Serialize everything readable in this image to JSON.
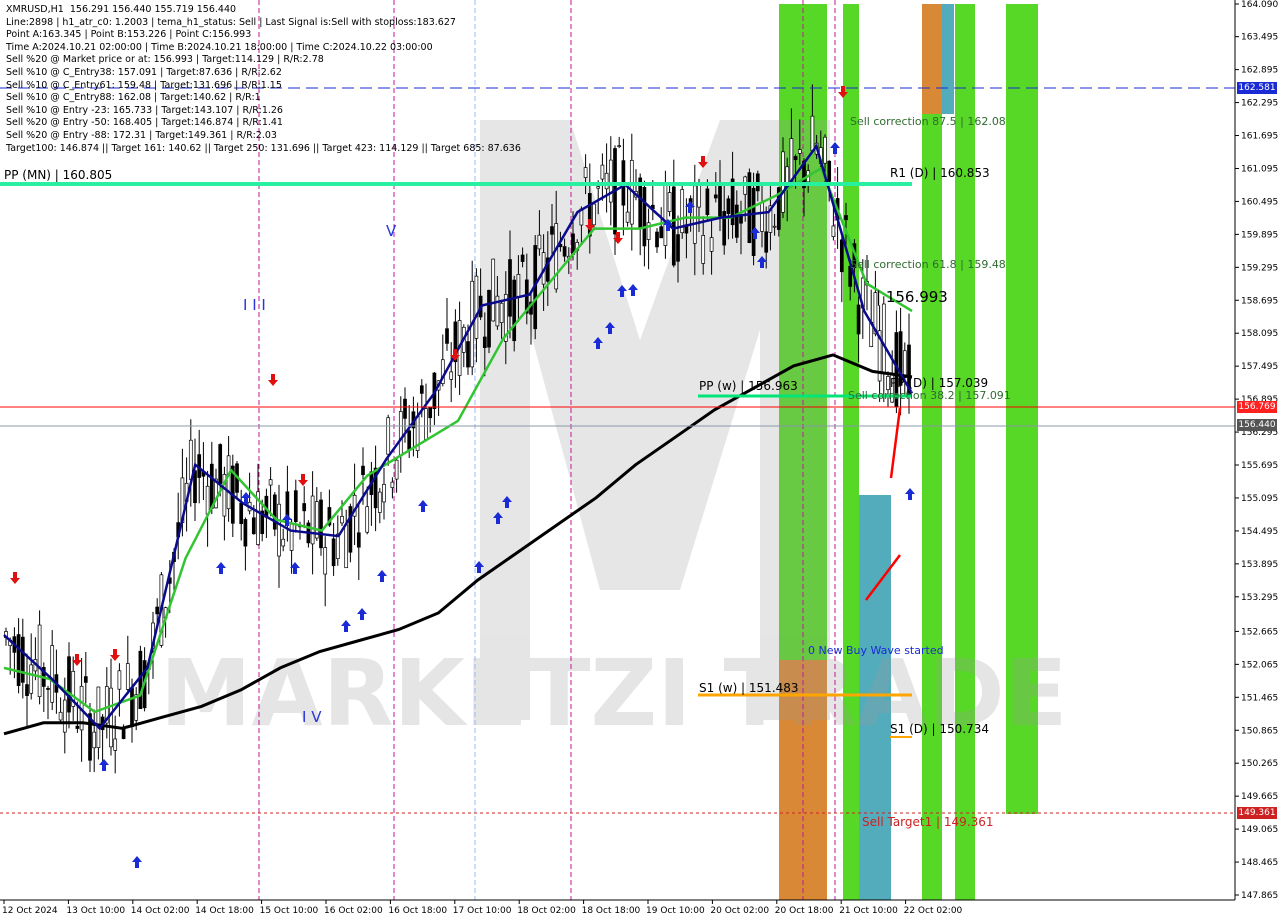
{
  "info_lines": [
    "XMRUSD,H1  156.291 156.440 155.719 156.440",
    "Line:2898 | h1_atr_c0: 1.2003 | tema_h1_status: Sell | Last Signal is:Sell with stoploss:183.627",
    "Point A:163.345 | Point B:153.226 | Point C:156.993",
    "Time A:2024.10.21 02:00:00 | Time B:2024.10.21 18:00:00 | Time C:2024.10.22 03:00:00",
    "Sell %20 @ Market price or at: 156.993 | Target:114.129 | R/R:2.78",
    "Sell %10 @ C_Entry38: 157.091 | Target:87.636 | R/R:2.62",
    "Sell %10 @ C_Entry61: 159.48 | Target:131.696 | R/R:1.15",
    "Sell %10 @ C_Entry88: 162.08 | Target:140.62 | R/R:1",
    "Sell %10 @ Entry -23: 165.733 | Target:143.107 | R/R:1.26",
    "Sell %20 @ Entry -50: 168.405 | Target:146.874 | R/R:1.41",
    "Sell %20 @ Entry -88: 172.31 | Target:149.361 | R/R:2.03",
    "Target100: 146.874 || Target 161: 140.62 || Target 250: 131.696 || Target 423: 114.129 || Target 685: 87.636"
  ],
  "watermark": "MARKETZI TRADE",
  "labels": {
    "pp_mn": "PP (MN) | 160.805",
    "r1_d": "R1 (D) | 160.853",
    "sell_corr_875": "Sell correction 87.5 | 162.08",
    "sell_corr_618": "Sell correction 61.8 | 159.48",
    "c_level": "| 156.993",
    "pp_w": "PP (w) | 156.963",
    "pp_d": "PP (D) | 157.039",
    "sell_corr_382": "Sell correction 38.2 | 157.091",
    "new_buy_wave": "0 New Buy Wave started",
    "s1_w": "S1 (w) | 151.483",
    "s1_d": "S1 (D) | 150.734",
    "sell_target1": "Sell Target1 | 149.361"
  },
  "wave_labels": [
    "V",
    "I I I",
    "I V"
  ],
  "price_tags": {
    "blue": "162.581",
    "red": "156.769",
    "gray": "156.440",
    "target": "149.361"
  },
  "chart_data": {
    "type": "line",
    "title": "XMRUSD,H1",
    "ylim": [
      147.865,
      164.09
    ],
    "y_ticks": [
      164.09,
      163.495,
      162.895,
      162.295,
      161.695,
      161.095,
      160.495,
      159.895,
      159.295,
      158.695,
      158.095,
      157.495,
      156.895,
      156.295,
      155.695,
      155.095,
      154.495,
      153.895,
      153.295,
      152.665,
      152.065,
      151.465,
      150.865,
      150.265,
      149.665,
      149.065,
      148.465,
      147.865
    ],
    "x_ticks": [
      "12 Oct 2024",
      "13 Oct 10:00",
      "14 Oct 02:00",
      "14 Oct 18:00",
      "15 Oct 10:00",
      "16 Oct 02:00",
      "16 Oct 18:00",
      "17 Oct 10:00",
      "18 Oct 02:00",
      "18 Oct 18:00",
      "19 Oct 10:00",
      "20 Oct 02:00",
      "20 Oct 18:00",
      "21 Oct 10:00",
      "22 Oct 02:00"
    ],
    "last": {
      "open": 156.291,
      "high": 156.44,
      "low": 155.719,
      "close": 156.44
    },
    "levels": [
      {
        "name": "PP (MN)",
        "value": 160.805,
        "color": "#27f0a0"
      },
      {
        "name": "R1 (D)",
        "value": 160.853,
        "color": "#27f0a0"
      },
      {
        "name": "PP (w)",
        "value": 156.963,
        "color": "#00e676"
      },
      {
        "name": "PP (D)",
        "value": 157.039,
        "color": "#27f0a0"
      },
      {
        "name": "S1 (w)",
        "value": 151.483,
        "color": "#ffa500"
      },
      {
        "name": "S1 (D)",
        "value": 150.734,
        "color": "#ffa500"
      },
      {
        "name": "Sell Target1",
        "value": 149.361,
        "color": "#cc2222"
      },
      {
        "name": "blue dashed",
        "value": 162.581,
        "color": "#1a2bd6"
      },
      {
        "name": "red line",
        "value": 156.769,
        "color": "#ff0000"
      }
    ],
    "series": [
      {
        "color": "#000000",
        "values": [
          150.8,
          151.0,
          151.0,
          150.9,
          151.1,
          151.3,
          151.6,
          152.0,
          152.3,
          152.5,
          152.7,
          153.0,
          153.6,
          154.1,
          154.6,
          155.1,
          155.7,
          156.2,
          156.7,
          157.1,
          157.5,
          157.7,
          157.4,
          157.3
        ]
      },
      {
        "color": "#31c531",
        "values": [
          152.0,
          151.8,
          151.2,
          151.5,
          154.0,
          155.6,
          154.7,
          154.5,
          155.5,
          156.0,
          156.5,
          158.0,
          159.0,
          160.0,
          160.0,
          160.2,
          160.2,
          160.6,
          161.1,
          159.0,
          158.5
        ]
      },
      {
        "color": "#0a0a8c",
        "values": [
          152.6,
          151.8,
          150.9,
          152.0,
          155.7,
          155.0,
          154.5,
          154.4,
          155.8,
          157.0,
          158.6,
          158.8,
          160.3,
          160.8,
          160.0,
          160.2,
          160.3,
          161.5,
          158.5,
          157.0
        ]
      }
    ]
  }
}
